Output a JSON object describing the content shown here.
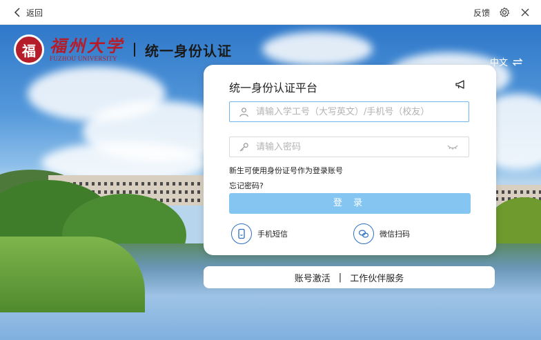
{
  "titlebar": {
    "back_label": "返回",
    "feedback_label": "反馈"
  },
  "header": {
    "university_cn": "福州大学",
    "seal_char": "福",
    "university_en": "FUZHOU UNIVERSITY",
    "system_title": "统一身份认证",
    "language": "中文"
  },
  "login": {
    "title": "统一身份认证平台",
    "username_placeholder": "请输入学工号（大写英文）/手机号（校友）",
    "password_placeholder": "请输入密码",
    "hint_text": "新生可使用身份证号作为登录账号",
    "forgot_label": "忘记密码?",
    "login_button": "登 录",
    "sms_label": "手机短信",
    "wechat_label": "微信扫码"
  },
  "footer": {
    "activate_label": "账号激活",
    "separator": "|",
    "partner_label": "工作伙伴服务"
  },
  "colors": {
    "brand_red": "#b51d2a",
    "button_blue": "#84c6f1",
    "icon_blue": "#2a6fc4"
  }
}
